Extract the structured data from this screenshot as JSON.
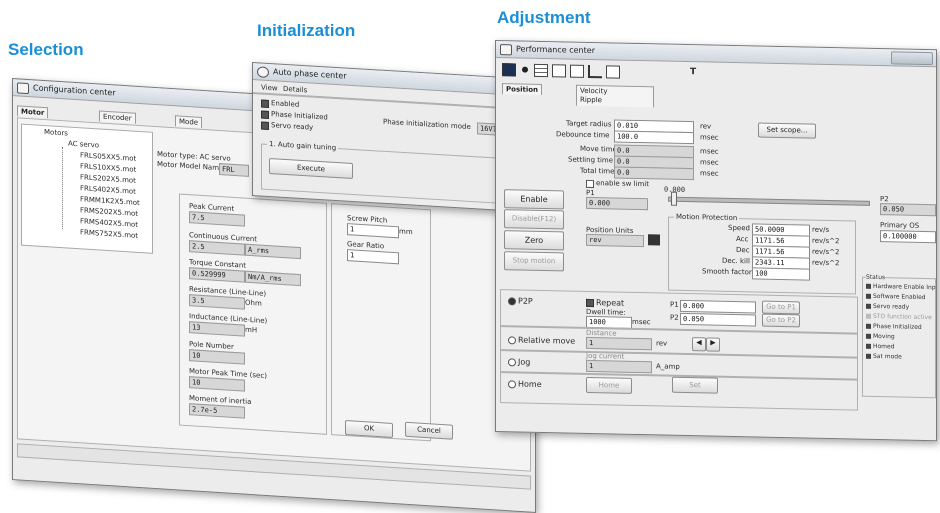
{
  "headings": {
    "selection": "Selection",
    "initialization": "Initialization",
    "adjustment": "Adjustment"
  },
  "config": {
    "title": "Configuration center",
    "tabs": [
      "Motor",
      "Encoder",
      "Mode"
    ],
    "tree": {
      "root": "Motors",
      "group": "AC servo",
      "files": [
        "FRLS05XX5.mot",
        "FRLS10XX5.mot",
        "FRLS202X5.mot",
        "FRLS402X5.mot",
        "FRMM1K2X5.mot",
        "FRMS202X5.mot",
        "FRMS402X5.mot",
        "FRMS752X5.mot"
      ]
    },
    "motor_type": "Motor type: AC servo",
    "motor_model_label": "Motor Model Name:",
    "motor_model_value": "FRL",
    "peak_current_label": "Peak Current",
    "peak_current_value": "7.5",
    "cont_current_label": "Continuous Current",
    "cont_current_value": "2.5",
    "cont_current_unit": "A_rms",
    "torque_label": "Torque Constant",
    "torque_value": "0.529999",
    "torque_unit": "Nm/A_rms",
    "resistance_label": "Resistance (Line-Line)",
    "resistance_value": "3.5",
    "resistance_unit": "Ohm",
    "inductance_label": "Inductance (Line-Line)",
    "inductance_value": "13",
    "inductance_unit": "mH",
    "pole_label": "Pole Number",
    "pole_value": "10",
    "peak_time_label": "Motor Peak Time (sec)",
    "peak_time_value": "10",
    "inertia_label": "Moment of inertia",
    "inertia_value": "2.7e-5",
    "screw_label": "Screw Pitch",
    "screw_value": "1",
    "screw_unit": "mm",
    "gear_label": "Gear Ratio",
    "gear_value": "1",
    "ok": "OK",
    "cancel": "Cancel"
  },
  "auto": {
    "title": "Auto phase center",
    "menu": [
      "View",
      "Details"
    ],
    "checks": [
      "Enabled",
      "Phase Initialized",
      "Servo ready"
    ],
    "phase_mode_label": "Phase initialization mode",
    "phase_mode_value": "16V1",
    "group_label": "1. Auto gain tuning",
    "execute": "Execute"
  },
  "perf": {
    "title": "Performance center",
    "toolbar_t": "T",
    "tab_position": "Position",
    "tab_velocity": "Velocity",
    "tab_ripple": "Ripple",
    "target_radius_label": "Target radius",
    "target_radius_value": "0.010",
    "target_radius_unit": "rev",
    "debounce_label": "Debounce time",
    "debounce_value": "100.0",
    "debounce_unit": "msec",
    "move_label": "Move time",
    "move_value": "0.0",
    "move_unit": "msec",
    "settling_label": "Settling time",
    "settling_value": "0.0",
    "settling_unit": "msec",
    "total_label": "Total time",
    "total_value": "0.0",
    "total_unit": "msec",
    "set_scope": "Set scope...",
    "enable_sw": "enable sw limit",
    "p1_label": "P1",
    "p1_value": "0.000",
    "p2_label": "P2",
    "p2_value": "0.050",
    "slider_value": "0.000",
    "enable": "Enable",
    "disable": "Disable(F12)",
    "zero": "Zero",
    "stop": "Stop motion",
    "pos_units_label": "Position Units",
    "pos_units_value": "rev",
    "motion_prot": "Motion Protection",
    "speed_label": "Speed",
    "speed_value": "50.0000",
    "speed_unit": "rev/s",
    "acc_label": "Acc",
    "acc_value": "1171.56",
    "acc_unit": "rev/s^2",
    "dec_label": "Dec",
    "dec_value": "1171.56",
    "dec_unit": "rev/s^2",
    "deckill_label": "Dec. kill",
    "deckill_value": "2343.11",
    "deckill_unit": "rev/s^2",
    "smooth_label": "Smooth factor",
    "smooth_value": "100",
    "primary_os_label": "Primary OS",
    "primary_os_value": "0.100000",
    "status_label": "Status",
    "status_items": [
      "Hardware Enable Input",
      "Software Enabled",
      "Servo ready",
      "STO function active",
      "Phase Initialized",
      "Moving",
      "Homed",
      "Sat mode"
    ],
    "p2p": "P2P",
    "repeat": "Repeat",
    "dwell_label": "Dwell time:",
    "dwell_value": "1000",
    "dwell_unit": "msec",
    "p2p_p1_label": "P1",
    "p2p_p1_value": "0.000",
    "p2p_p2_label": "P2",
    "p2p_p2_value": "0.050",
    "goto_p1": "Go to P1",
    "goto_p2": "Go to P2",
    "relative": "Relative move",
    "distance_label": "Distance",
    "distance_value": "1",
    "distance_unit": "rev",
    "jog": "Jog",
    "jog_current_label": "Jog current",
    "jog_current_value": "1",
    "jog_unit": "A_amp",
    "home": "Home",
    "home_btn": "Home",
    "set": "Set"
  }
}
